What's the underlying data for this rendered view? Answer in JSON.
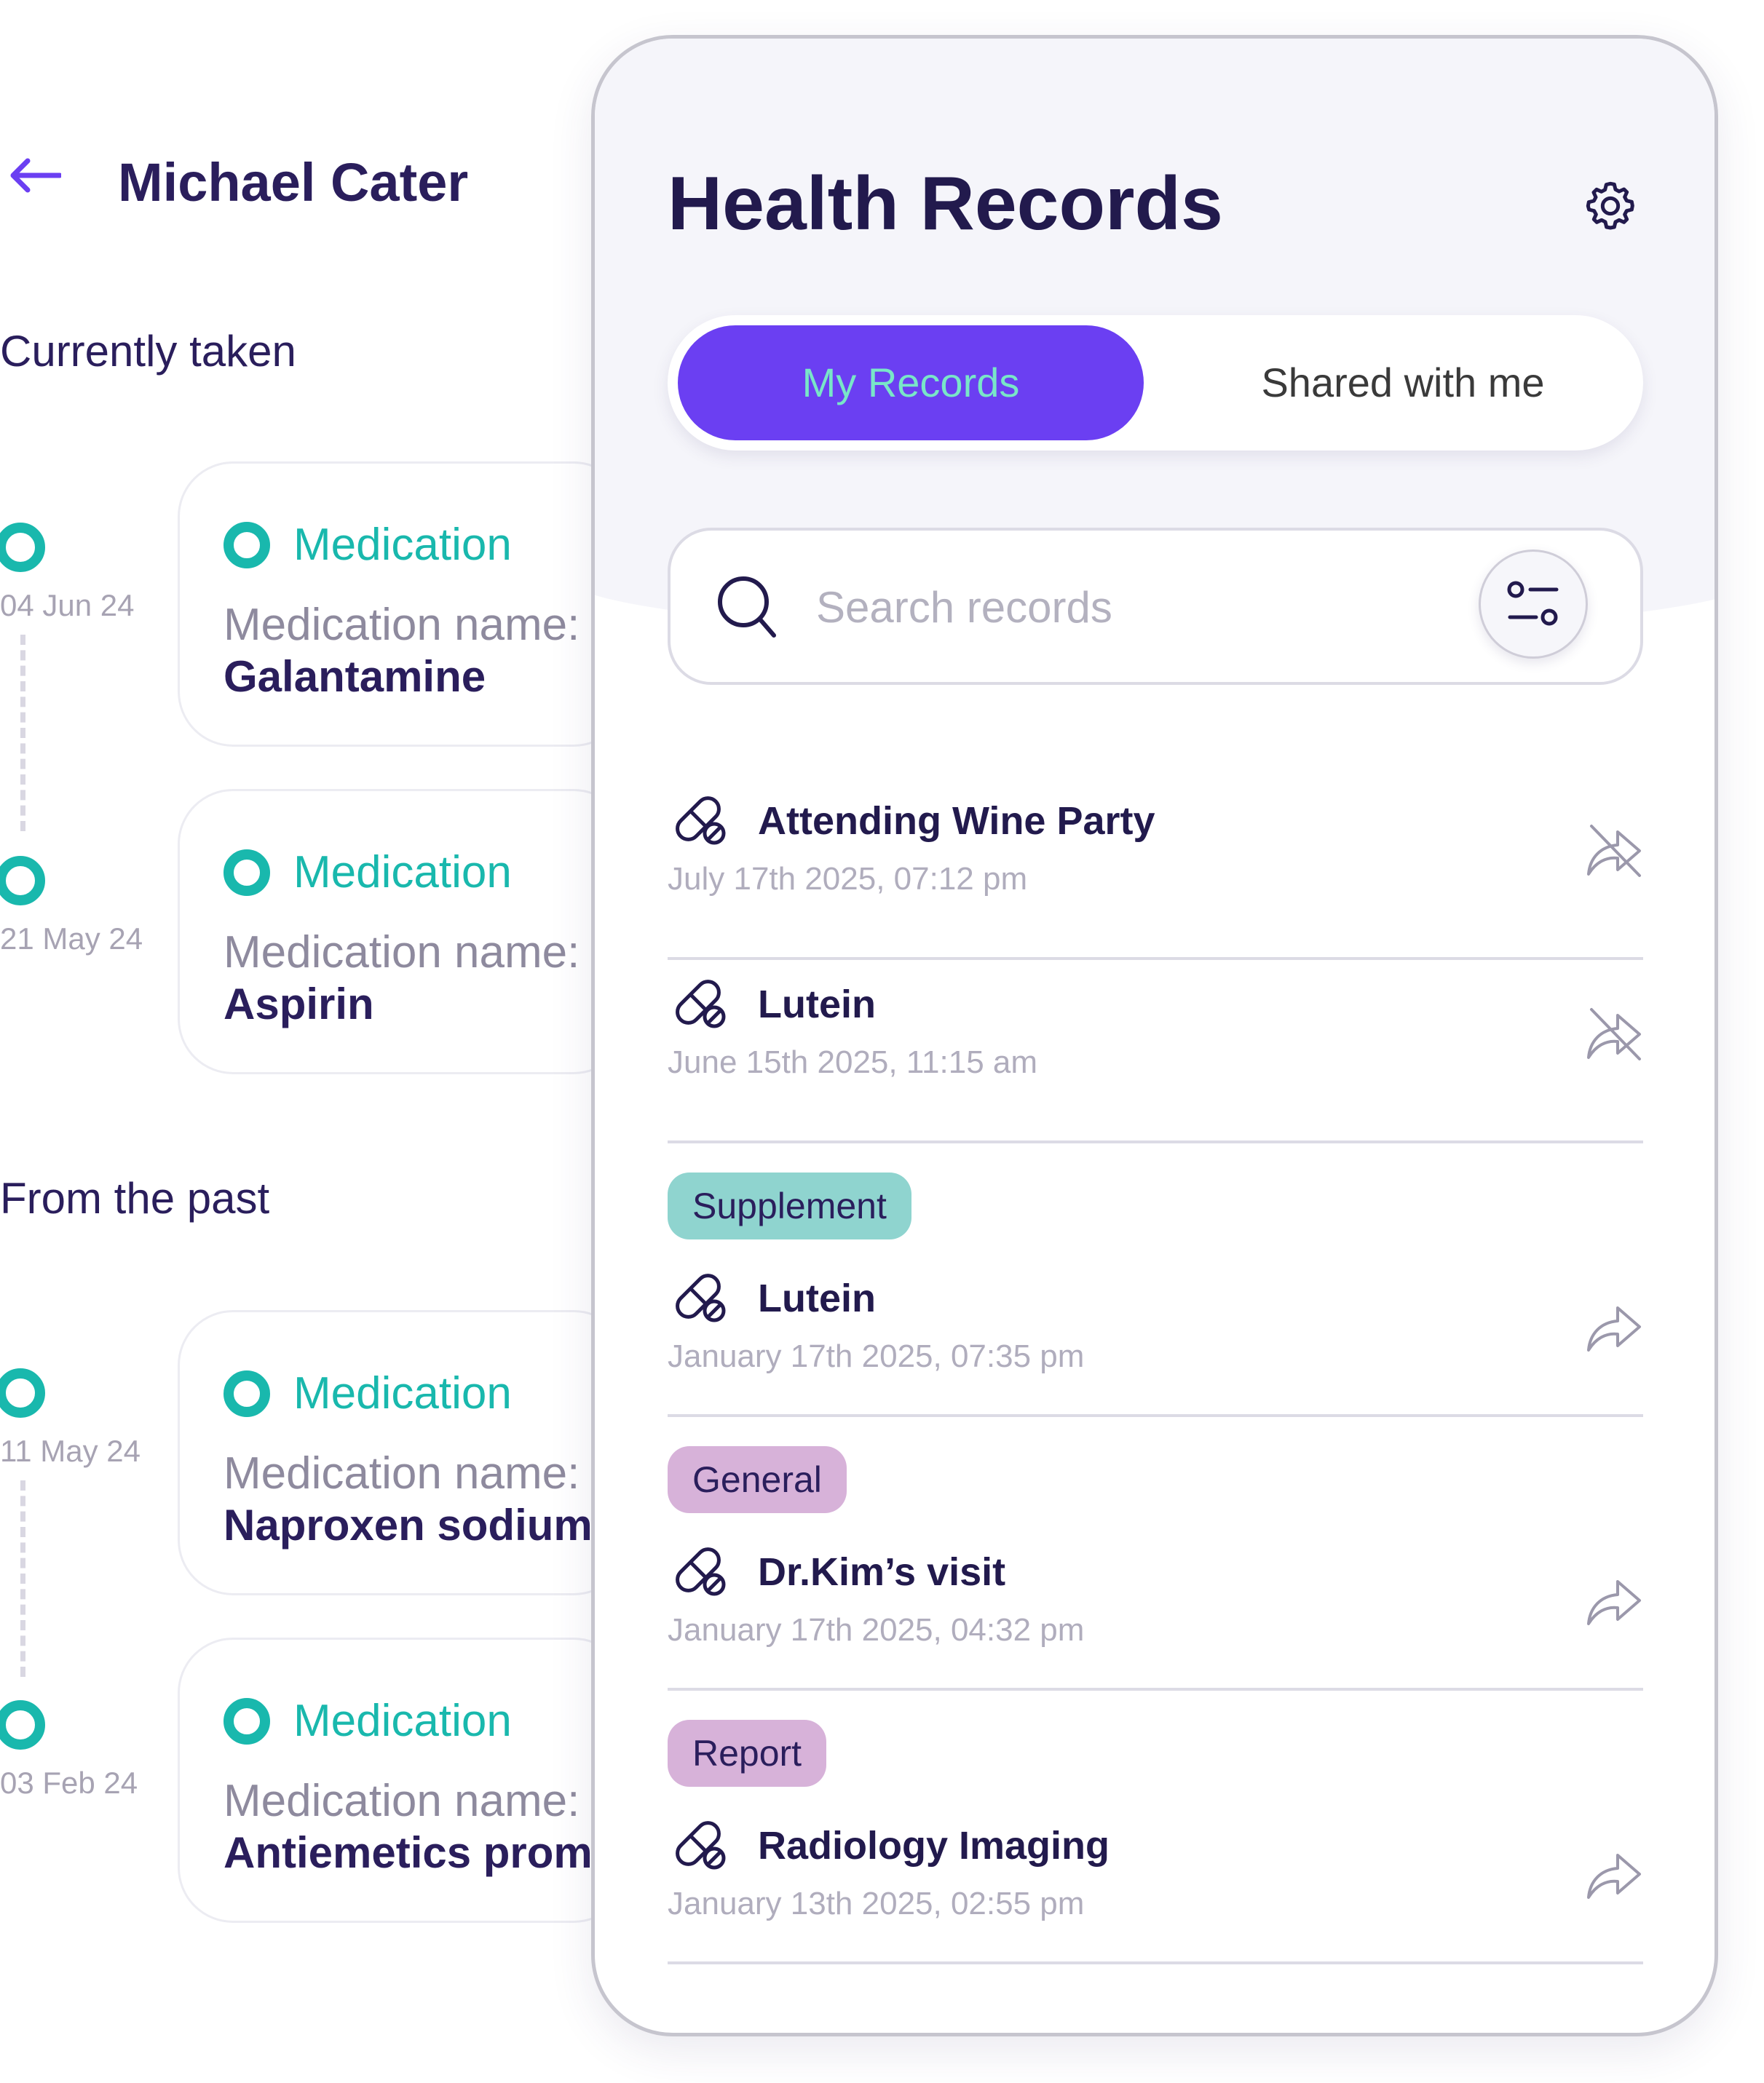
{
  "back_screen": {
    "patient_name": "Michael Cater",
    "sections": [
      {
        "title": "Currently taken",
        "items": [
          {
            "date": "04 Jun 24",
            "type": "Medication",
            "label": "Medication name:",
            "value": "Galantamine"
          },
          {
            "date": "21 May 24",
            "type": "Medication",
            "label": "Medication name:",
            "value": "Aspirin"
          }
        ]
      },
      {
        "title": "From the past",
        "items": [
          {
            "date": "11 May 24",
            "type": "Medication",
            "label": "Medication name:",
            "value": "Naproxen sodium"
          },
          {
            "date": "03 Feb 24",
            "type": "Medication",
            "label": "Medication name:",
            "value": "Antiemetics prome"
          }
        ]
      }
    ]
  },
  "health_records": {
    "title": "Health Records",
    "tabs": [
      {
        "label": "My Records",
        "active": true
      },
      {
        "label": "Shared with me",
        "active": false
      }
    ],
    "search": {
      "placeholder": "Search records",
      "value": ""
    },
    "records": [
      {
        "tag": null,
        "title": "Attending Wine Party",
        "date": "July 17th 2025, 07:12 pm",
        "action": "share-off-icon"
      },
      {
        "tag": null,
        "title": "Lutein",
        "date": "June 15th 2025, 11:15 am",
        "action": "share-off-icon"
      },
      {
        "tag": "Supplement",
        "title": "Lutein",
        "date": "January 17th 2025, 07:35 pm",
        "action": "share-icon"
      },
      {
        "tag": "General",
        "title": "Dr.Kim’s visit",
        "date": "January 17th 2025, 04:32 pm",
        "action": "share-icon"
      },
      {
        "tag": "Report",
        "title": "Radiology Imaging",
        "date": "January 13th 2025, 02:55 pm",
        "action": "share-icon"
      }
    ]
  },
  "colors": {
    "accent_purple": "#6b3ff2",
    "accent_teal": "#19b8ad",
    "tag_supplement": "#8fd4cf",
    "tag_general": "#d7b2d9",
    "tag_report": "#d7b2d9",
    "text_dark": "#221a4d"
  }
}
